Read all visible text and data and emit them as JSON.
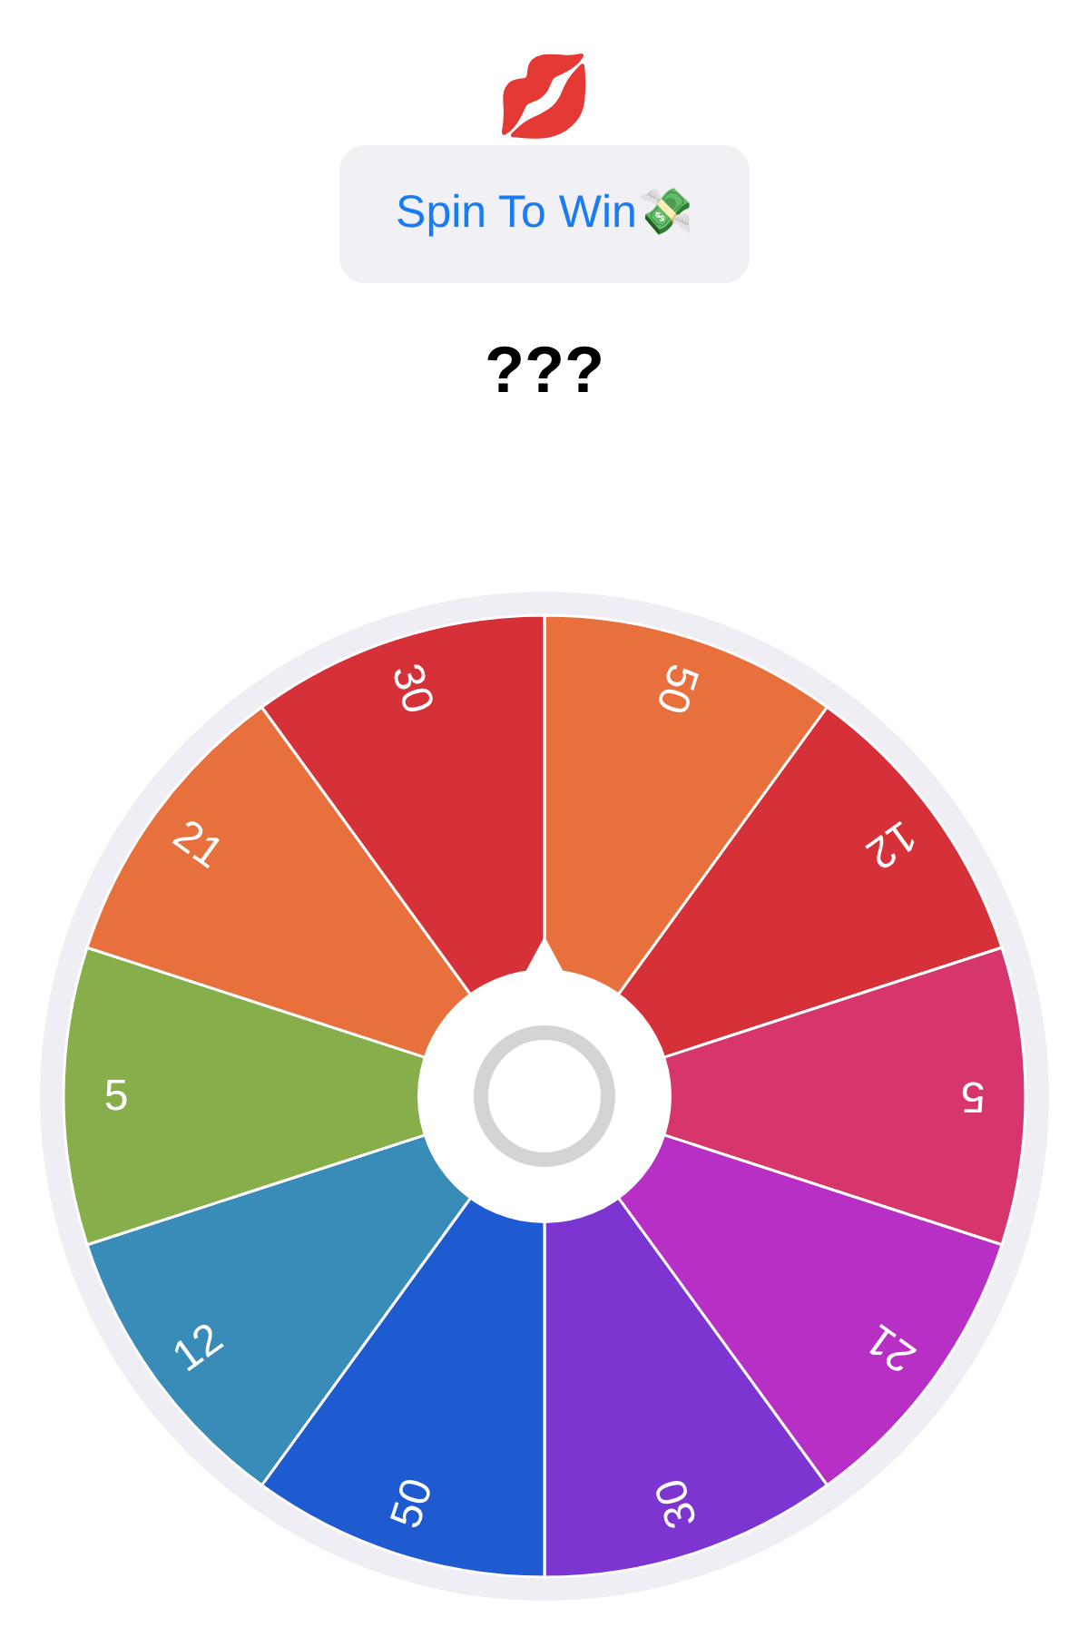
{
  "header_emoji": "💋",
  "spin_button": {
    "label": "Spin To Win💸"
  },
  "result": "???",
  "wheel": {
    "segments": [
      {
        "label": "50",
        "color": "#e8703c"
      },
      {
        "label": "12",
        "color": "#d63138"
      },
      {
        "label": "5",
        "color": "#d6366b"
      },
      {
        "label": "21",
        "color": "#b82fc6"
      },
      {
        "label": "30",
        "color": "#7c35d1"
      },
      {
        "label": "50",
        "color": "#1f5bd0"
      },
      {
        "label": "12",
        "color": "#3a8cb8"
      },
      {
        "label": "5",
        "color": "#86ae4a"
      },
      {
        "label": "21",
        "color": "#e8703c"
      },
      {
        "label": "30",
        "color": "#d63138"
      }
    ]
  }
}
